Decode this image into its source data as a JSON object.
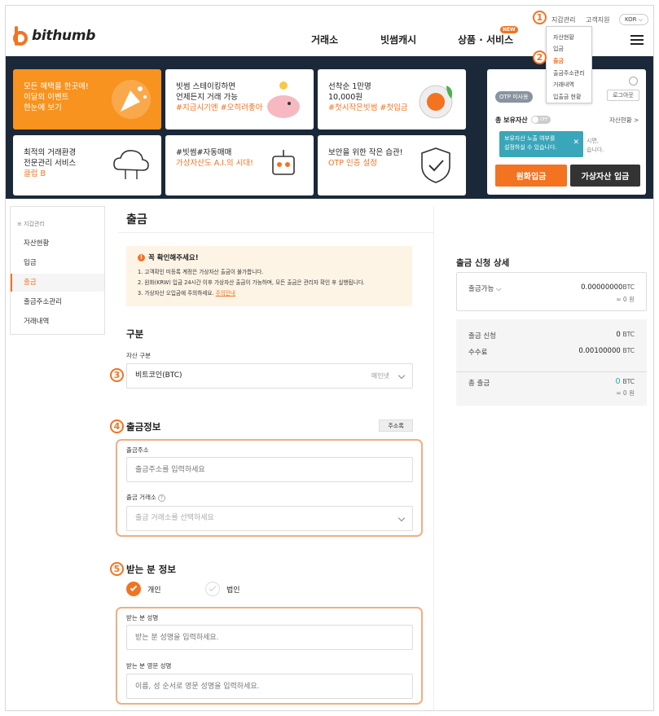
{
  "header": {
    "logo_text": "bithumb",
    "nav": [
      "거래소",
      "빗썸캐시",
      "상품 · 서비스"
    ],
    "new_badge": "NEW",
    "util_links": [
      "지갑관리",
      "고객지원"
    ],
    "lang": "KOR ⌵",
    "dropdown": [
      "자산현황",
      "입금",
      "출금",
      "출금주소관리",
      "거래내역",
      "입출금 현황"
    ]
  },
  "annotations": [
    "1",
    "2",
    "3",
    "4",
    "5"
  ],
  "banner": {
    "cards": [
      {
        "lines": [
          "모든 혜택을 한곳에!",
          "이달의 이벤트",
          "한눈에 보기"
        ],
        "highlight": ""
      },
      {
        "lines": [
          "빗썸 스테이킹하면",
          "언제든지 거래 가능"
        ],
        "highlight": "#지금시기엔 #오히려좋아"
      },
      {
        "lines": [
          "선착순 1만명",
          "10,000원"
        ],
        "highlight": "#첫시작은빗썸 #첫입금"
      },
      {
        "lines": [
          "최적의 거래환경",
          "전문관리 서비스"
        ],
        "highlight": "클럽 B"
      },
      {
        "lines": [
          "#빗썸#자동매매"
        ],
        "highlight": "가상자산도 A.I.의 시대!"
      },
      {
        "lines": [
          "보안을 위한 작은 습관!"
        ],
        "highlight": "OTP 인증 설정"
      }
    ],
    "wallet": {
      "otp": "OTP 미사용",
      "logout": "로그아웃",
      "total_label": "총 보유자산",
      "toggle": "OFF",
      "asset_link": "자산현황 >",
      "tooltip": [
        "보유자산 노출 여부를",
        "설정하실 수 있습니다."
      ],
      "hint": [
        "시면,",
        "습니다."
      ],
      "krw_btn": "원화입금",
      "crypto_btn": "가상자산 입금"
    }
  },
  "sidebar": {
    "head": "≡  지갑관리",
    "items": [
      "자산현황",
      "입금",
      "출금",
      "출금주소관리",
      "거래내역"
    ]
  },
  "main": {
    "title": "출금",
    "notice": {
      "title": "꼭 확인해주세요!",
      "lines": [
        "1. 고객확인 미등록 계정은 가상자산 출금이 불가합니다.",
        "2. 원화(KRW) 입금 24시간 이후 가상자산 출금이 가능하며, 모든 출금은 관리자 확인 후 실행됩니다.",
        "3. 가상자산 오입금에 주의하세요."
      ],
      "link": "주의안내"
    },
    "section1": {
      "title": "구분",
      "label": "자산 구분",
      "value": "비트코인(BTC)",
      "suffix": "메인넷"
    },
    "section2": {
      "title": "출금정보",
      "addr_btn": "주소록",
      "addr_label": "출금주소",
      "addr_placeholder": "출금주소를 입력하세요",
      "exch_label": "출금 거래소",
      "exch_help": "?",
      "exch_placeholder": "출금 거래소를 선택하세요"
    },
    "section3": {
      "title": "받는 분 정보",
      "radio": [
        "개인",
        "법인"
      ],
      "name_label": "받는 분 성명",
      "name_placeholder": "받는 분 성명을 입력하세요.",
      "en_label": "받는 분 영문 성명",
      "en_placeholder": "이름, 성 순서로 영문 성명을 입력하세요."
    }
  },
  "right_panel": {
    "title": "출금 신청 상세",
    "available_label": "출금가능 ⌵",
    "available_value": "0.00000000",
    "available_unit": "BTC",
    "available_krw": "≈ 0 원",
    "request_label": "출금 신청",
    "request_value": "0",
    "fee_label": "수수료",
    "fee_value": "0.00100000",
    "total_label": "총 출금",
    "total_value": "0",
    "total_krw": "≈ 0 원",
    "unit": "BTC"
  },
  "colors": {
    "accent": "#f37321",
    "banner_bg": "#1a2839",
    "tooltip": "#3aa6b9"
  }
}
